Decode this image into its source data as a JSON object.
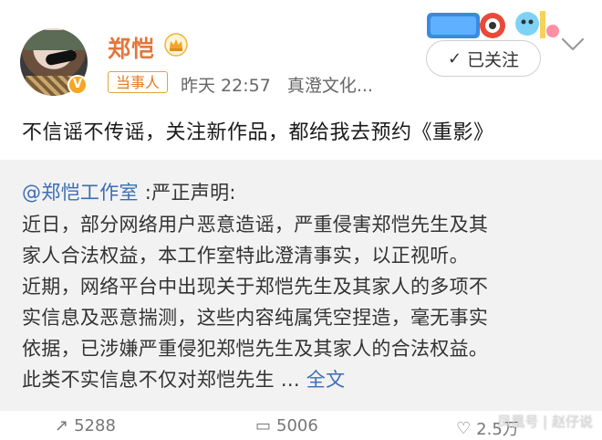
{
  "user": {
    "name": "郑恺",
    "badge_label": "当事人",
    "time": "昨天 22:57",
    "source": "真澄文化..."
  },
  "follow_button": {
    "label": "已关注",
    "icon": "check-icon"
  },
  "post": {
    "text": "不信谣不传谣，关注新作品，都给我去预约《重影》"
  },
  "repost": {
    "mention": "@郑恺工作室",
    "title_suffix": ":严正声明:",
    "lines": [
      "近日，部分网络用户恶意造谣，严重侵害郑恺先生及其",
      "家人合法权益，本工作室特此澄清事实，以正视听。",
      "近期，网络平台中出现关于郑恺先生及其家人的多项不",
      "实信息及恶意揣测，这些内容纯属凭空捏造，毫无事实",
      "依据，已涉嫌严重侵犯郑恺先生及其家人的合法权益。",
      "此类不实信息不仅对郑恺先生 ..."
    ],
    "full_text_link": "全文"
  },
  "actions": {
    "repost_count": "5288",
    "comment_count": "5006",
    "like_count": "2.5万"
  },
  "watermark": "凤凰号 | 赵仔说",
  "colors": {
    "username": "#e3763a",
    "link": "#3b6cb6",
    "repost_bg": "#f2f2f2",
    "badge_border": "#e3a23a"
  }
}
